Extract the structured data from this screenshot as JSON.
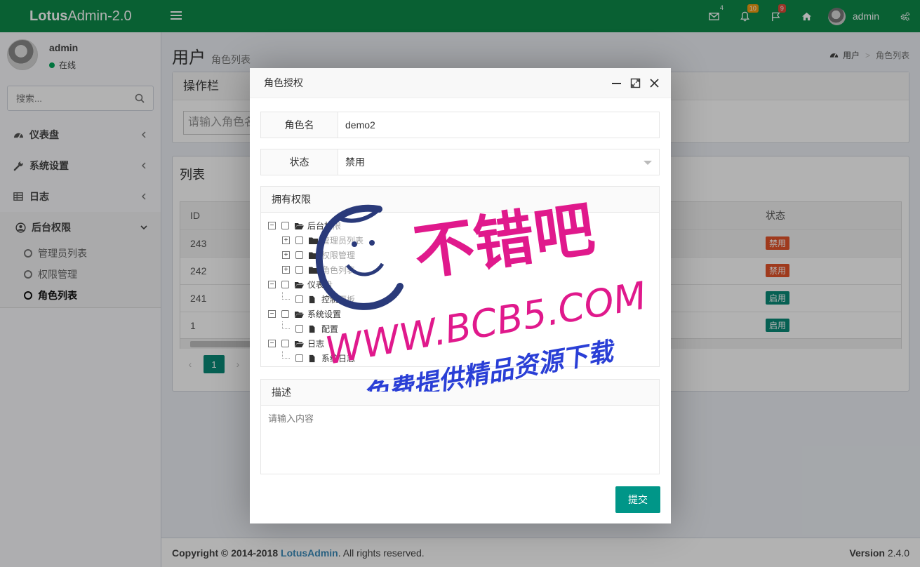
{
  "header": {
    "logo_bold": "Lotus",
    "logo_rest": "Admin-2.0",
    "mail_count": "4",
    "bell_count": "10",
    "flag_count": "9",
    "user_name": "admin"
  },
  "sidebar": {
    "user_name": "admin",
    "user_status": "在线",
    "search_placeholder": "搜索...",
    "menu": [
      {
        "label": "仪表盘"
      },
      {
        "label": "系统设置"
      },
      {
        "label": "日志"
      },
      {
        "label": "后台权限"
      }
    ],
    "submenu": [
      {
        "label": "管理员列表"
      },
      {
        "label": "权限管理"
      },
      {
        "label": "角色列表"
      }
    ]
  },
  "content": {
    "title": "用户",
    "subtitle": "角色列表",
    "breadcrumb_root": "用户",
    "breadcrumb_current": "角色列表",
    "ops_title": "操作栏",
    "filter_placeholder": "请输入角色名",
    "list_title": "列表",
    "table": {
      "col_id": "ID",
      "col_status": "状态",
      "rows": [
        {
          "id": "243",
          "status": "禁用"
        },
        {
          "id": "242",
          "status": "禁用"
        },
        {
          "id": "241",
          "status": "启用"
        },
        {
          "id": "1",
          "status": "启用"
        }
      ]
    },
    "page_current": "1"
  },
  "footer": {
    "copyright": "Copyright © 2014-2018",
    "brand": "LotusAdmin",
    "rights": ". All rights reserved.",
    "version_label": "Version",
    "version": "2.4.0"
  },
  "modal": {
    "title": "角色授权",
    "role_label": "角色名",
    "role_value": "demo2",
    "status_label": "状态",
    "status_value": "禁用",
    "perm_title": "拥有权限",
    "tree": [
      "后台权限",
      "管理员列表",
      "权限管理",
      "角色列表",
      "仪表盘",
      "控制面板",
      "系统设置",
      "配置",
      "日志",
      "系统日志"
    ],
    "desc_title": "描述",
    "desc_placeholder": "请输入内容",
    "submit": "提交"
  },
  "watermark": {
    "line1": "不错吧",
    "line2": "WWW.BCB5.COM",
    "line3": "免费提供精品资源下载"
  },
  "colors": {
    "header_bg": "#0d8a4a",
    "primary": "#009688",
    "danger_tag": "#e4542a",
    "success_tag": "#0a8a78",
    "watermark_pink": "#e0198c",
    "watermark_blue": "#2a3fd6"
  }
}
